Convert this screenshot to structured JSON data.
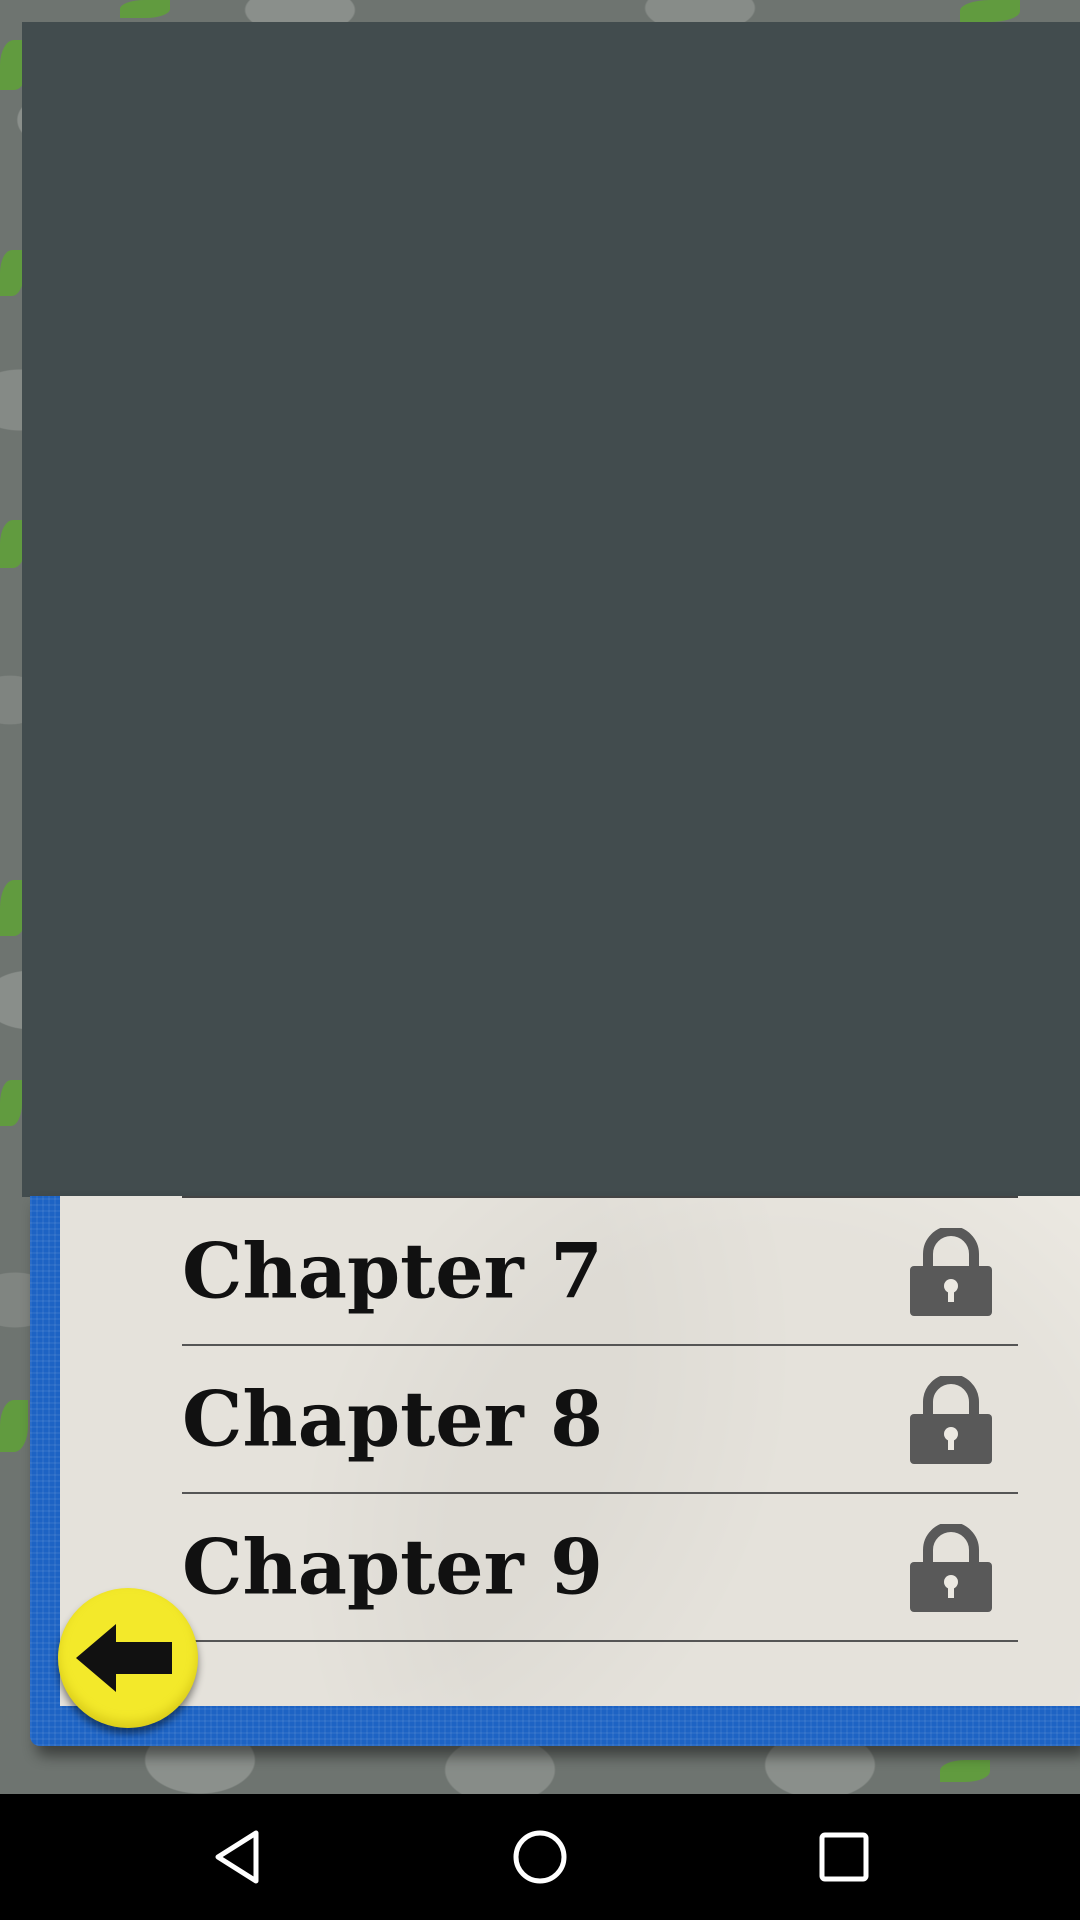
{
  "chapters": [
    {
      "label": "Chapter 7",
      "locked": true
    },
    {
      "label": "Chapter 8",
      "locked": true
    },
    {
      "label": "Chapter 9",
      "locked": true
    }
  ],
  "icons": {
    "lock": "lock-icon",
    "back": "back-arrow-icon",
    "nav_back": "nav-back-icon",
    "nav_home": "nav-home-icon",
    "nav_recents": "nav-recents-icon"
  },
  "colors": {
    "panel": "#424c4e",
    "book_cover": "#1d63c4",
    "page": "#ece9e2",
    "back_button": "#f3e92a",
    "lock": "#595959"
  }
}
